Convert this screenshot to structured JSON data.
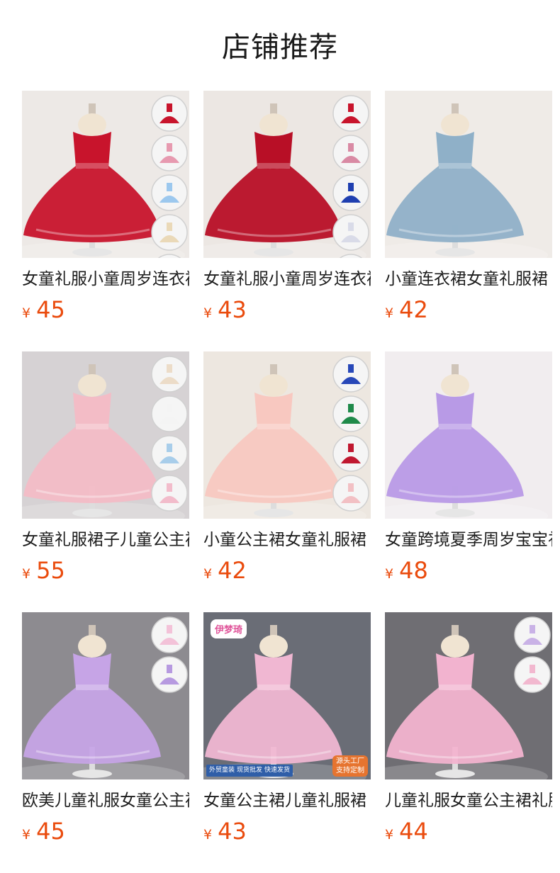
{
  "page_title": "店铺推荐",
  "products": [
    {
      "name": "女童礼服小童周岁连衣裙",
      "currency": "¥",
      "price": "45",
      "dress_color": "#c8142c",
      "bg": "#ede9e6",
      "swatches": [
        "#c8142c",
        "#e79ab0",
        "#9cc8ee",
        "#ead9b8",
        "#f2f2f2"
      ]
    },
    {
      "name": "女童礼服小童周岁连衣裙",
      "currency": "¥",
      "price": "43",
      "dress_color": "#b80f26",
      "bg": "#ece7e3",
      "swatches": [
        "#c8142c",
        "#d98aa4",
        "#1f3fb0",
        "#d9dbe8",
        "#e8d6aa"
      ]
    },
    {
      "name": "小童连衣裙女童礼服裙",
      "currency": "¥",
      "price": "42",
      "dress_color": "#8fb0c8",
      "bg": "#efebe7",
      "swatches": []
    },
    {
      "name": "女童礼服裙子儿童公主裙",
      "currency": "¥",
      "price": "55",
      "dress_color": "#f3bcc6",
      "bg": "#d6d2d4",
      "swatches": [
        "#ecdcc8",
        "#f4f4f4",
        "#a8cdea",
        "#f2bccb"
      ]
    },
    {
      "name": "小童公主裙女童礼服裙",
      "currency": "¥",
      "price": "42",
      "dress_color": "#f8c8c0",
      "bg": "#ede7e0",
      "swatches": [
        "#2848b8",
        "#1f8a4a",
        "#c01830",
        "#f2c0c4"
      ]
    },
    {
      "name": "女童跨境夏季周岁宝宝礼服",
      "currency": "¥",
      "price": "48",
      "dress_color": "#b89ae6",
      "bg": "#f1edef",
      "swatches": []
    },
    {
      "name": "欧美儿童礼服女童公主裙",
      "currency": "¥",
      "price": "45",
      "dress_color": "#c6a4e6",
      "bg": "#8d8b90",
      "swatches": [
        "#f3c2d8",
        "#b79ae0"
      ]
    },
    {
      "name": "女童公主裙儿童礼服裙",
      "currency": "¥",
      "price": "43",
      "dress_color": "#f0b7d2",
      "bg": "#6a6d76",
      "swatches": [],
      "badge_brand": "伊梦琦",
      "badge_tags": [
        "外贸童装",
        "现货批发",
        "快速发货"
      ],
      "badge_corner": [
        "源头工厂",
        "支持定制"
      ]
    },
    {
      "name": "儿童礼服女童公主裙礼服",
      "currency": "¥",
      "price": "44",
      "dress_color": "#f2b3cf",
      "bg": "#6f6e73",
      "swatches": [
        "#c9b2e6",
        "#f2b8cf"
      ]
    }
  ]
}
